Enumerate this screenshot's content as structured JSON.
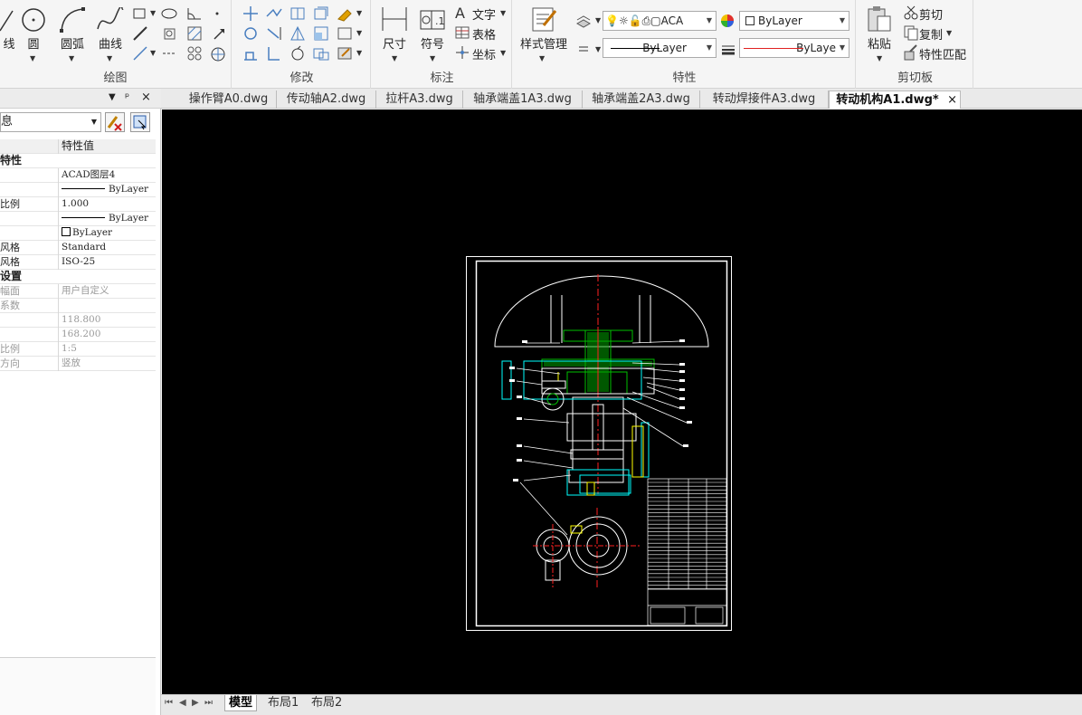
{
  "ribbon": {
    "draw": {
      "title": "绘图",
      "line_label": "线",
      "circle_label": "圆",
      "arc_label": "圆弧",
      "curve_label": "曲线"
    },
    "modify": {
      "title": "修改"
    },
    "annotate": {
      "title": "标注",
      "dimension_label": "尺寸",
      "symbol_label": "符号",
      "text_label": "文字",
      "table_label": "表格",
      "coord_label": "坐标"
    },
    "properties": {
      "title": "特性",
      "style_mgr_label": "样式管理",
      "layer_value": "ACA",
      "color_value": "ByLayer",
      "linetype_value": "ByLayer",
      "lineweight_value": "ByLaye"
    },
    "clipboard": {
      "title": "剪切板",
      "paste_label": "粘贴",
      "cut_label": "剪切",
      "copy_label": "复制",
      "match_label": "特性匹配"
    }
  },
  "tabs": [
    {
      "label": "操作臂A0.dwg"
    },
    {
      "label": "传动轴A2.dwg"
    },
    {
      "label": "拉杆A3.dwg"
    },
    {
      "label": "轴承端盖1A3.dwg"
    },
    {
      "label": "轴承端盖2A3.dwg"
    },
    {
      "label": "转动焊接件A3.dwg"
    },
    {
      "label": "转动机构A1.dwg*",
      "close": "×"
    }
  ],
  "palette": {
    "select_value": "息",
    "col_header": "特性值",
    "rows": [
      {
        "k": "特性",
        "v": "",
        "type": "section"
      },
      {
        "k": "",
        "v": "ACAD图层4"
      },
      {
        "k": "",
        "v": "ByLayer",
        "line": true
      },
      {
        "k": "比例",
        "v": "1.000"
      },
      {
        "k": "",
        "v": "ByLayer",
        "line": true
      },
      {
        "k": "",
        "v": "ByLayer",
        "box": true
      },
      {
        "k": "风格",
        "v": "Standard"
      },
      {
        "k": "风格",
        "v": "ISO-25"
      },
      {
        "k": "设置",
        "v": "",
        "type": "section"
      },
      {
        "k": "幅面",
        "v": "用户自定义",
        "dim": true
      },
      {
        "k": "系数",
        "v": "",
        "dim": true
      },
      {
        "k": "",
        "v": "118.800",
        "dim": true
      },
      {
        "k": "",
        "v": "168.200",
        "dim": true
      },
      {
        "k": "比例",
        "v": "1:5",
        "dim": true
      },
      {
        "k": "方向",
        "v": "竖放",
        "dim": true
      }
    ]
  },
  "layout_tabs": [
    {
      "label": "模型",
      "active": true
    },
    {
      "label": "布局1"
    },
    {
      "label": "布局2"
    }
  ],
  "colors": {
    "canvas": "#000000",
    "drawing_line": "#ffffff",
    "center_line": "#ff2020",
    "part_green": "#00c000",
    "hidden_cyan": "#00ffff",
    "accent_yellow": "#ffff00"
  }
}
